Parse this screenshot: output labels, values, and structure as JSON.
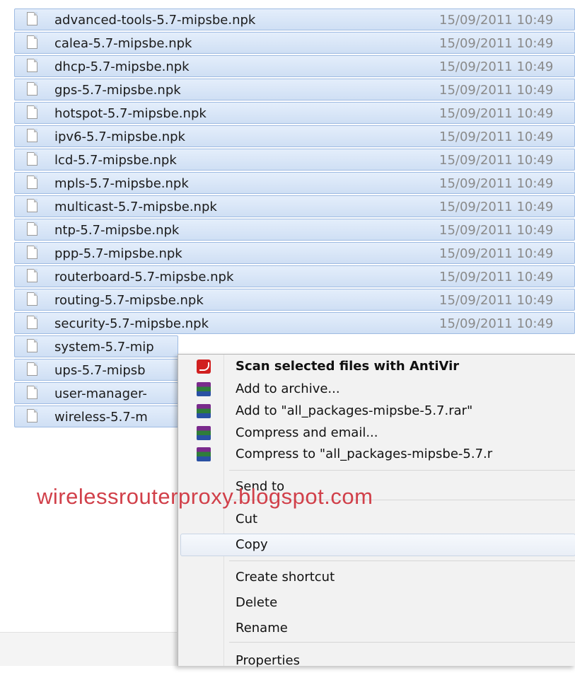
{
  "files": [
    {
      "name": "advanced-tools-5.7-mipsbe.npk",
      "date": "15/09/2011 10:49"
    },
    {
      "name": "calea-5.7-mipsbe.npk",
      "date": "15/09/2011 10:49"
    },
    {
      "name": "dhcp-5.7-mipsbe.npk",
      "date": "15/09/2011 10:49"
    },
    {
      "name": "gps-5.7-mipsbe.npk",
      "date": "15/09/2011 10:49"
    },
    {
      "name": "hotspot-5.7-mipsbe.npk",
      "date": "15/09/2011 10:49"
    },
    {
      "name": "ipv6-5.7-mipsbe.npk",
      "date": "15/09/2011 10:49"
    },
    {
      "name": "lcd-5.7-mipsbe.npk",
      "date": "15/09/2011 10:49"
    },
    {
      "name": "mpls-5.7-mipsbe.npk",
      "date": "15/09/2011 10:49"
    },
    {
      "name": "multicast-5.7-mipsbe.npk",
      "date": "15/09/2011 10:49"
    },
    {
      "name": "ntp-5.7-mipsbe.npk",
      "date": "15/09/2011 10:49"
    },
    {
      "name": "ppp-5.7-mipsbe.npk",
      "date": "15/09/2011 10:49"
    },
    {
      "name": "routerboard-5.7-mipsbe.npk",
      "date": "15/09/2011 10:49"
    },
    {
      "name": "routing-5.7-mipsbe.npk",
      "date": "15/09/2011 10:49"
    },
    {
      "name": "security-5.7-mipsbe.npk",
      "date": "15/09/2011 10:49"
    },
    {
      "name": "system-5.7-mip",
      "date": ""
    },
    {
      "name": "ups-5.7-mipsb",
      "date": ""
    },
    {
      "name": "user-manager-",
      "date": ""
    },
    {
      "name": "wireless-5.7-m",
      "date": ""
    }
  ],
  "context_menu": {
    "scan": "Scan selected files with AntiVir",
    "add_archive": "Add to archive...",
    "add_rar": "Add to \"all_packages-mipsbe-5.7.rar\"",
    "compress_email": "Compress and email...",
    "compress_rar": "Compress to \"all_packages-mipsbe-5.7.r",
    "send_to": "Send to",
    "cut": "Cut",
    "copy": "Copy",
    "create_shortcut": "Create shortcut",
    "delete": "Delete",
    "rename": "Rename",
    "properties": "Properties"
  },
  "watermark": "wirelessrouterproxy.blogspot.com",
  "colors": {
    "selection": "#cfdff4",
    "selection_border": "#9fbbe2",
    "watermark": "#d1404a",
    "menu_bg": "#f2f2f2"
  }
}
